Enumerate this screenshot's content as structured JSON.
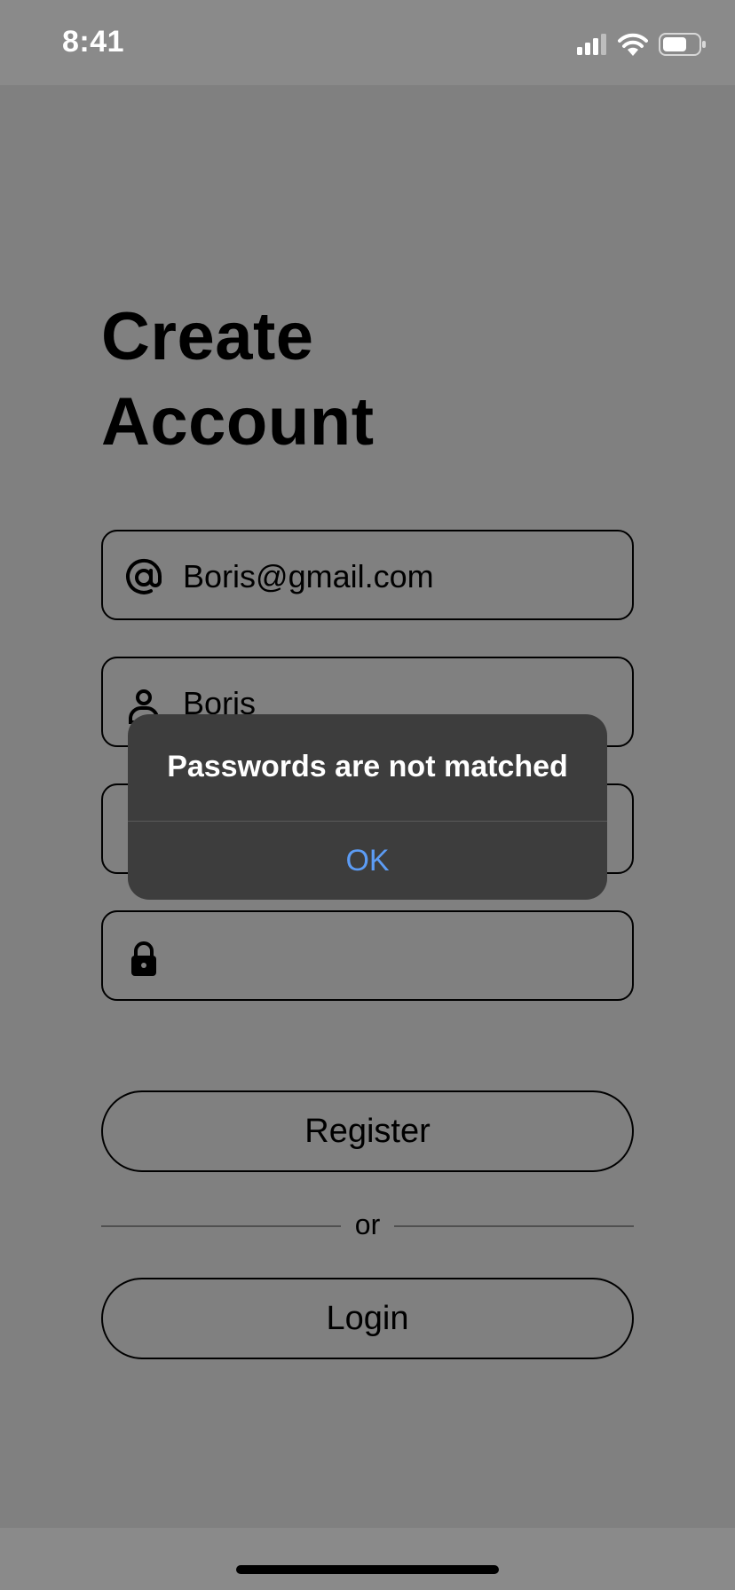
{
  "status_bar": {
    "time": "8:41"
  },
  "title": {
    "line1": "Create",
    "line2": "Account"
  },
  "fields": {
    "email": {
      "value": "Boris@gmail.com",
      "icon": "at-icon"
    },
    "name": {
      "value": "Boris",
      "icon": "person-icon"
    },
    "password": {
      "value": "",
      "icon": "lock-icon"
    },
    "confirm_password": {
      "value": "",
      "icon": "lock-icon"
    }
  },
  "buttons": {
    "register": "Register",
    "or": "or",
    "login": "Login"
  },
  "alert": {
    "message": "Passwords are not matched",
    "ok": "OK"
  },
  "colors": {
    "accent": "#5c9cf5",
    "overlay": "#808080",
    "alert_bg": "#3d3d3d"
  }
}
